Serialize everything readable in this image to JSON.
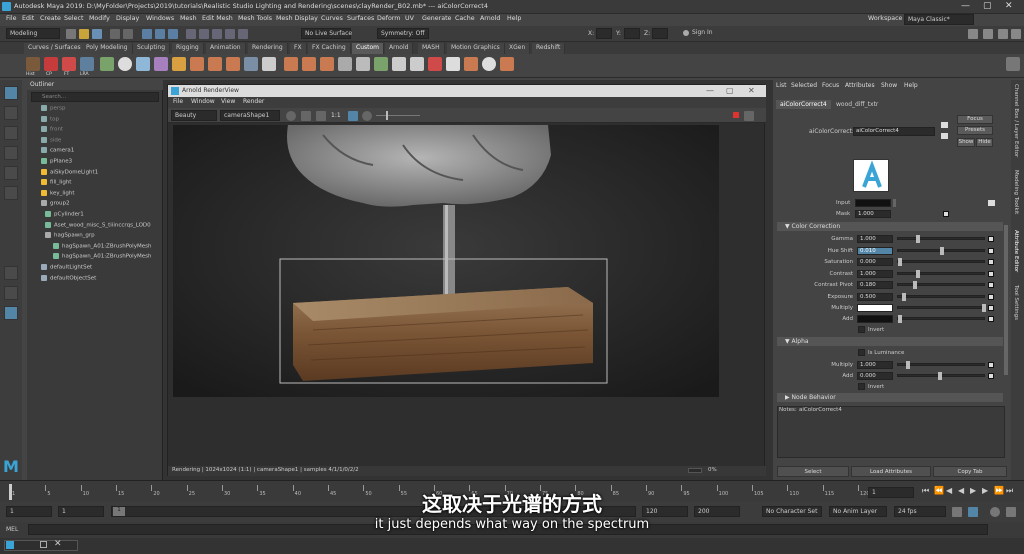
{
  "window": {
    "title": "Autodesk Maya 2019: D:\\MyFolder\\Projects\\2019\\tutorials\\Realistic Studio Lighting and Rendering\\scenes\\clayRender_B02.mb*   ---   aiColorCorrect4",
    "minimize": "—",
    "maximize": "▢",
    "close": "✕"
  },
  "menubar": {
    "items": [
      "File",
      "Edit",
      "Create",
      "Select",
      "Modify",
      "Display",
      "Windows",
      "Mesh",
      "Edit Mesh",
      "Mesh Tools",
      "Mesh Display",
      "Curves",
      "Surfaces",
      "Deform",
      "UV",
      "Generate",
      "Cache",
      "Arnold",
      "Help"
    ],
    "workspace_label": "Workspace :",
    "workspace_value": "Maya Classic*"
  },
  "statusline": {
    "mode": "Modeling",
    "live_surface": "No Live Surface",
    "symmetry": "Symmetry: Off",
    "x_label": "X:",
    "y_label": "Y:",
    "z_label": "Z:",
    "sign_in": "Sign In"
  },
  "shelf": {
    "tabs": [
      "Curves / Surfaces",
      "Poly Modeling",
      "Sculpting",
      "Rigging",
      "Animation",
      "Rendering",
      "FX",
      "FX Caching",
      "Custom",
      "Arnold",
      "MASH",
      "Motion Graphics",
      "XGen",
      "Redshift"
    ],
    "active_tab": "Custom",
    "buttons": [
      "Hist",
      "CP",
      "FT",
      "LRA"
    ]
  },
  "outliner": {
    "menu": "Outliner",
    "search_placeholder": "Search...",
    "items": [
      {
        "label": "persp",
        "dim": true
      },
      {
        "label": "top",
        "dim": true
      },
      {
        "label": "front",
        "dim": true
      },
      {
        "label": "side",
        "dim": true
      },
      {
        "label": "camera1",
        "dim": false
      },
      {
        "label": "pPlane3",
        "dim": false
      },
      {
        "label": "aiSkyDomeLight1",
        "dim": false
      },
      {
        "label": "fill_light",
        "dim": false
      },
      {
        "label": "key_light",
        "dim": false
      },
      {
        "label": "group2",
        "dim": false
      },
      {
        "label": "pCylinder1",
        "dim": false
      },
      {
        "label": "Aset_wood_misc_S_tiiinccrqs_LOD0",
        "dim": false
      },
      {
        "label": "hagSpawn_grp",
        "dim": false
      },
      {
        "label": "hagSpawn_A01:ZBrushPolyMesh",
        "dim": false
      },
      {
        "label": "hagSpawn_A01:ZBrushPolyMesh",
        "dim": false
      },
      {
        "label": "defaultLightSet",
        "dim": false
      },
      {
        "label": "defaultObjectSet",
        "dim": false
      }
    ]
  },
  "renderview": {
    "title": "Arnold RenderView",
    "menu": [
      "File",
      "Window",
      "View",
      "Render"
    ],
    "aov": "Beauty",
    "camera": "cameraShape1",
    "ratio": "1:1",
    "status": "Rendering | 1024x1024 (1:1) | cameraShape1 | samples 4/1/1/0/2/2",
    "zoom": "0%"
  },
  "attribute_editor": {
    "menu": [
      "List",
      "Selected",
      "Focus",
      "Attributes",
      "Show",
      "Help"
    ],
    "tabs": [
      "aiColorCorrect4",
      "wood_diff_txtr"
    ],
    "node_label": "aiColorCorrect:",
    "node_value": "aiColorCorrect4",
    "focus": "Focus",
    "presets": "Presets",
    "show": "Show",
    "hide": "Hide",
    "input_label": "Input",
    "mask_label": "Mask",
    "mask_value": "1.000",
    "color_correction_section": "Color Correction",
    "fields": [
      {
        "label": "Gamma",
        "value": "1.000",
        "knob": 0.22
      },
      {
        "label": "Hue Shift",
        "value": "0.010",
        "knob": 0.5
      },
      {
        "label": "Saturation",
        "value": "0.000",
        "knob": 0.0
      },
      {
        "label": "Contrast",
        "value": "1.000",
        "knob": 0.22
      },
      {
        "label": "Contrast Pivot",
        "value": "0.180",
        "knob": 0.18
      },
      {
        "label": "Exposure",
        "value": "0.500",
        "knob": 0.05
      }
    ],
    "multiply_label": "Multiply",
    "add_label": "Add",
    "invert_label": "Invert",
    "alpha_section": "Alpha",
    "is_luminance_label": "Is Luminance",
    "alpha_multiply_label": "Multiply",
    "alpha_multiply_value": "1.000",
    "alpha_add_label": "Add",
    "alpha_add_value": "0.000",
    "alpha_invert_label": "Invert",
    "node_behavior_section": "Node Behavior",
    "notes_label": "Notes:",
    "notes_value": "aiColorCorrect4",
    "select_button": "Select",
    "load_attributes_button": "Load Attributes",
    "copy_tab_button": "Copy Tab"
  },
  "side_tabs": [
    "Channel Box / Layer Editor",
    "Modeling Toolkit",
    "Attribute Editor",
    "Tool Settings"
  ],
  "timeslider": {
    "ticks": [
      "1",
      "5",
      "10",
      "15",
      "20",
      "25",
      "30",
      "35",
      "40",
      "45",
      "50",
      "55",
      "60",
      "65",
      "70",
      "75",
      "80",
      "85",
      "90",
      "95",
      "100",
      "105",
      "110",
      "115",
      "120"
    ],
    "current_frame": "1"
  },
  "rangeslider": {
    "start": "1",
    "start_inner": "1",
    "range_start_marker": "1",
    "end_inner": "120",
    "end": "200",
    "character_set": "No Character Set",
    "anim_layer": "No Anim Layer",
    "fps": "24 fps"
  },
  "cmdline": {
    "label": "MEL"
  },
  "subtitles": {
    "chinese": "这取决于光谱的方式",
    "english": "it just depends what way on the spectrum"
  },
  "colors": {
    "maya_bg": "#444444",
    "panel_dark": "#2b2b2b",
    "highlight_blue": "#5285a6",
    "arnold_logo": "#3aa4d6"
  }
}
